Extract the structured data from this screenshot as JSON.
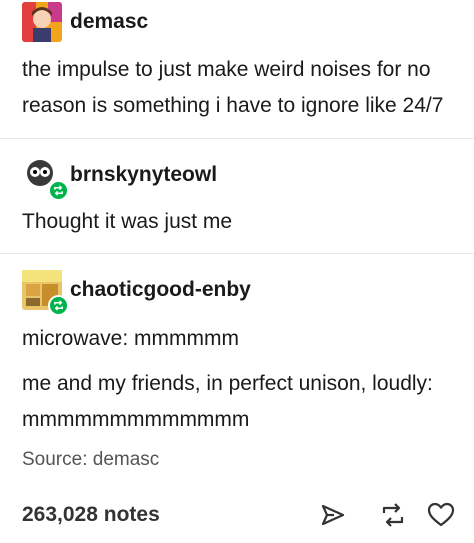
{
  "posts": [
    {
      "username": "demasc",
      "body": [
        "the impulse to just make weird noises for no",
        "reason is something i have to ignore like 24/7"
      ]
    },
    {
      "username": "brnskynyteowl",
      "body": [
        "Thought it was just me"
      ]
    },
    {
      "username": "chaoticgood-enby",
      "body": [
        "microwave: mmmmmm"
      ],
      "body2": [
        "me and my friends, in perfect unison, loudly:",
        "mmmmmmmmmmmmm"
      ]
    }
  ],
  "source_label": "Source: demasc",
  "notes": "263,028 notes",
  "icons": {
    "share": "share-icon",
    "reblog": "reblog-icon",
    "like": "heart-icon"
  },
  "colors": {
    "reblog_green": "#00b34d",
    "text": "#1a1a1a"
  }
}
